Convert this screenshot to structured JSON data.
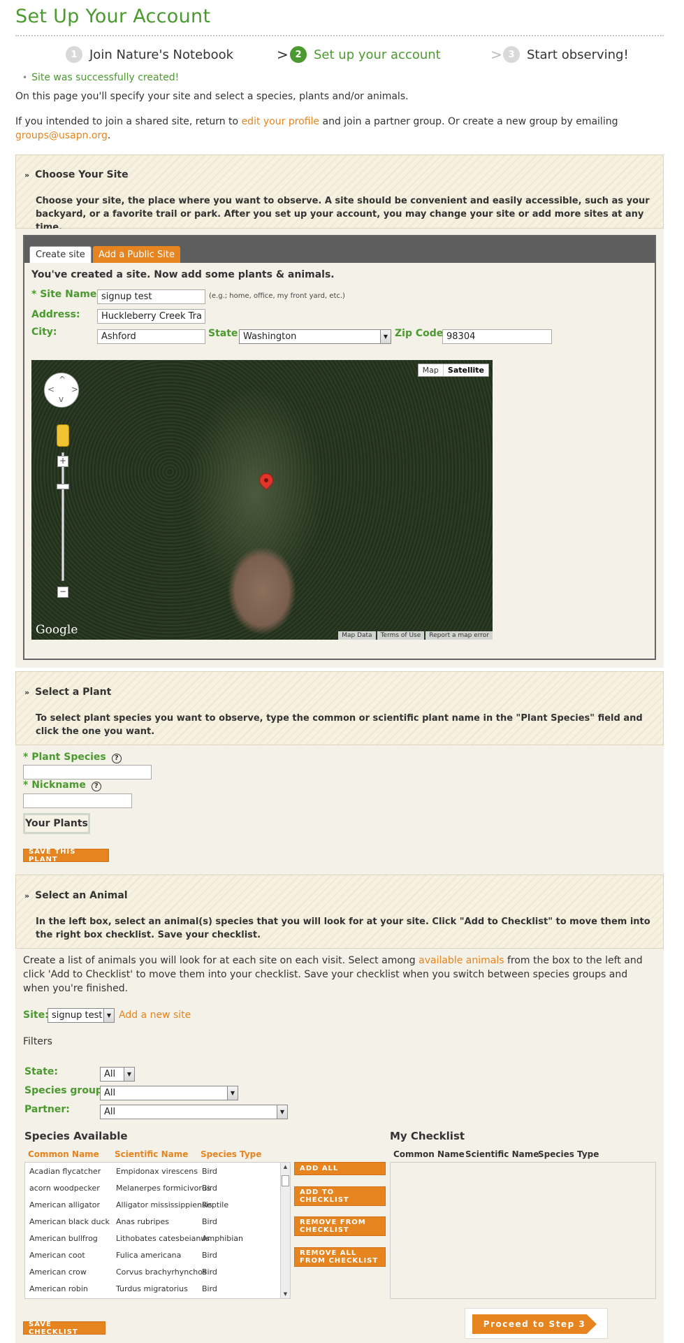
{
  "page": {
    "title": "Set Up Your Account",
    "steps": [
      {
        "num": "1",
        "label": "Join Nature's Notebook"
      },
      {
        "num": "2",
        "label": "Set up your account"
      },
      {
        "num": "3",
        "label": "Start observing!"
      }
    ],
    "success_message": "Site was successfully created!",
    "intro": "On this page you'll specify your site and select a species, plants and/or animals.",
    "shared_text_1": "If you intended to join a shared site, return to",
    "edit_profile_link": "edit your profile",
    "shared_text_2": "and join a partner group. Or create a new group by emailing",
    "groups_email": "groups@usapn.org",
    "period": "."
  },
  "site_section": {
    "heading": "Choose Your Site",
    "body": "Choose your site, the place where you want to observe. A site should be convenient and easily accessible, such as your backyard, or a favorite trail or park. After you set up your account, you may change your site or add more sites at any time.",
    "tabs": {
      "create": "Create site",
      "public": "Add a Public Site"
    },
    "created_msg": "You've created a site. Now add some plants & animals.",
    "site_name_label": "* Site Name:",
    "site_name_value": "signup test",
    "site_name_hint": "(e.g.; home, office, my front yard, etc.)",
    "address_label": "Address:",
    "address_value": "Huckleberry Creek Trail",
    "city_label": "City:",
    "city_value": "Ashford",
    "state_label": "State:",
    "state_value": "Washington",
    "zip_label": "Zip Code:",
    "zip_value": "98304",
    "map": {
      "type_map": "Map",
      "type_satellite": "Satellite",
      "google": "Google",
      "footer": [
        "Map Data",
        "Terms of Use",
        "Report a map error"
      ]
    }
  },
  "plant_section": {
    "heading": "Select a Plant",
    "body": "To select plant species you want to observe, type the common or scientific plant name in the \"Plant Species\" field and click the one you want.",
    "species_label": "* Plant Species",
    "nickname_label": "* Nickname",
    "help": "?",
    "your_plants": "Your Plants",
    "save_button": "Save this plant"
  },
  "animal_section": {
    "heading": "Select an Animal",
    "body": "In the left box, select an animal(s) species that you will look for at your site. Click \"Add to Checklist\" to move them into the right box checklist. Save your checklist.",
    "desc_1": "Create a list of animals you will look for at each site on each visit. Select among",
    "available_link": "available animals",
    "desc_2": "from the box to the left and click 'Add to Checklist' to move them into your checklist. Save your checklist when you switch between species groups and when you're finished.",
    "site_label": "Site:",
    "site_value": "signup test",
    "add_site_link": "Add a new site",
    "filters_label": "Filters",
    "state_filter_label": "State:",
    "state_filter_value": "All",
    "group_filter_label": "Species group:",
    "group_filter_value": "All",
    "partner_filter_label": "Partner:",
    "partner_filter_value": "All",
    "available_heading": "Species Available",
    "checklist_heading": "My Checklist",
    "columns": [
      "Common Name",
      "Scientific Name",
      "Species Type"
    ],
    "species": [
      {
        "common": "Acadian flycatcher",
        "scientific": "Empidonax virescens",
        "type": "Bird"
      },
      {
        "common": "acorn woodpecker",
        "scientific": "Melanerpes formicivorus",
        "type": "Bird"
      },
      {
        "common": "American alligator",
        "scientific": "Alligator mississippiensis",
        "type": "Reptile"
      },
      {
        "common": "American black duck",
        "scientific": "Anas rubripes",
        "type": "Bird"
      },
      {
        "common": "American bullfrog",
        "scientific": "Lithobates catesbeianus",
        "type": "Amphibian"
      },
      {
        "common": "American coot",
        "scientific": "Fulica americana",
        "type": "Bird"
      },
      {
        "common": "American crow",
        "scientific": "Corvus brachyrhynchos",
        "type": "Bird"
      },
      {
        "common": "American robin",
        "scientific": "Turdus migratorius",
        "type": "Bird"
      }
    ],
    "add_all": "Add all",
    "add_to_checklist": "Add to checklist",
    "remove_from_checklist": "Remove from checklist",
    "remove_all": "Remove all from checklist",
    "save_checklist": "Save checklist",
    "proceed": "Proceed to Step 3"
  },
  "colors": {
    "accent_green": "#4b9a2f",
    "accent_orange": "#e6841f",
    "cream": "#f4f1e8"
  },
  "icons": [
    "chevron-down-icon",
    "help-icon",
    "map-pin-icon",
    "pegman-icon",
    "dropdown-arrow-icon"
  ]
}
